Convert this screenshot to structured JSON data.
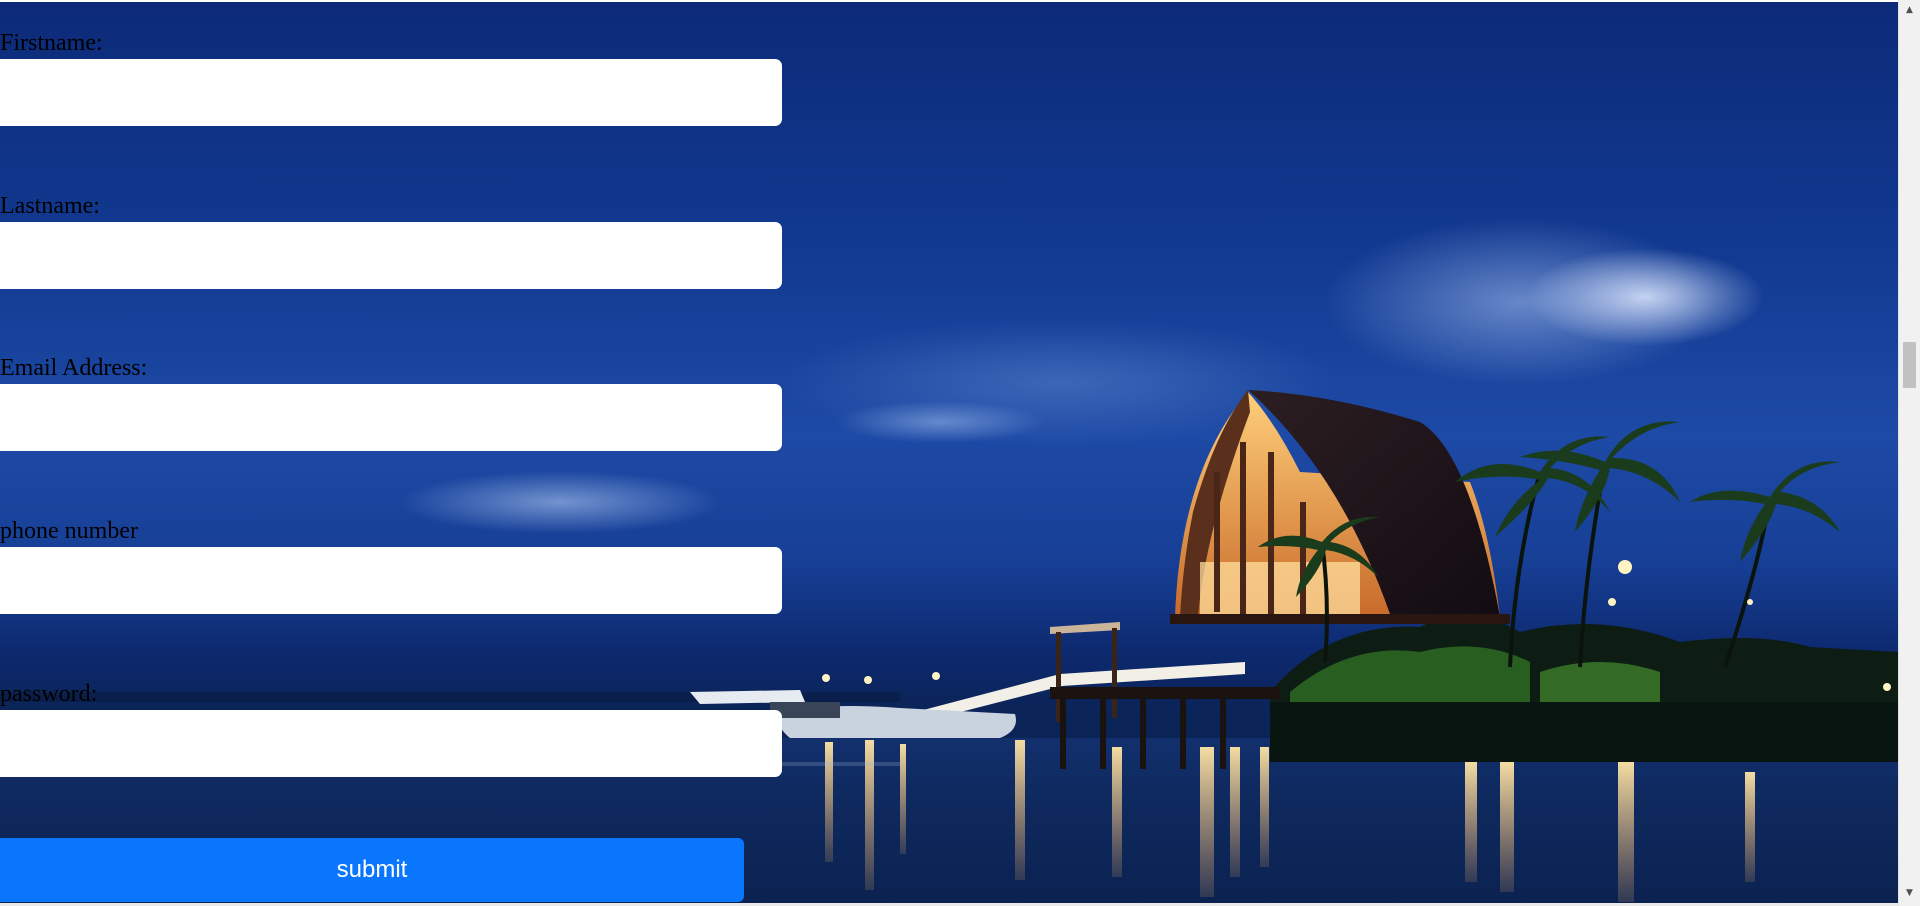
{
  "form": {
    "fields": [
      {
        "label": "Firstname:",
        "value": ""
      },
      {
        "label": "Lastname:",
        "value": ""
      },
      {
        "label": "Email Address:",
        "value": ""
      },
      {
        "label": "phone number",
        "value": ""
      },
      {
        "label": "password:",
        "value": ""
      }
    ],
    "submit_label": "submit"
  },
  "background": {
    "subject": "night resort with thatched pavilion, pier, palm trees and lit water reflections"
  },
  "scrollbar": {
    "up_icon": "chevron-up-icon",
    "down_icon": "chevron-down-icon"
  },
  "colors": {
    "sky": "#123a92",
    "submit_button": "#0a76fe",
    "input_background": "#ffffff",
    "label_text": "#000000"
  }
}
